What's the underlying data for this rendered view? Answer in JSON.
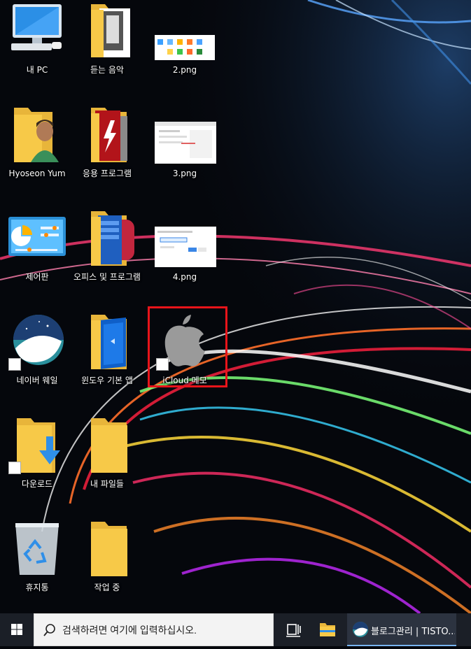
{
  "desktop": {
    "icons": [
      {
        "label": "내 PC",
        "icon": "computer-icon"
      },
      {
        "label": "듣는 음악",
        "icon": "folder-icon"
      },
      {
        "label": "2.png",
        "icon": "image-file-icon"
      },
      {
        "label": "Hyoseon Yum",
        "icon": "user-folder-icon"
      },
      {
        "label": "응용 프로그램",
        "icon": "folder-icon"
      },
      {
        "label": "3.png",
        "icon": "image-file-icon"
      },
      {
        "label": "제어판",
        "icon": "control-panel-icon"
      },
      {
        "label": "오피스 및 프로그램",
        "icon": "folder-icon"
      },
      {
        "label": "4.png",
        "icon": "image-file-icon"
      },
      {
        "label": "네이버 웨일",
        "icon": "naver-whale-icon"
      },
      {
        "label": "윈도우 기본 앱",
        "icon": "folder-icon"
      },
      {
        "label": "iCloud 메모",
        "icon": "apple-icon"
      },
      {
        "label": "다운로드",
        "icon": "downloads-folder-icon"
      },
      {
        "label": "내 파일들",
        "icon": "folder-icon"
      },
      {
        "label": "휴지통",
        "icon": "recycle-bin-icon"
      },
      {
        "label": "작업 중",
        "icon": "folder-icon"
      }
    ]
  },
  "taskbar": {
    "search_placeholder": "검색하려면 여기에 입력하십시오.",
    "open_app_label": "블로그관리 | TISTO...",
    "start_icon": "windows-logo-icon",
    "search_icon": "search-icon",
    "taskview_icon": "task-view-icon",
    "explorer_icon": "file-explorer-icon"
  },
  "colors": {
    "highlight_border": "#e8141a",
    "taskbar_bg": "#1b1f27",
    "folder_yellow": "#f7c948"
  }
}
